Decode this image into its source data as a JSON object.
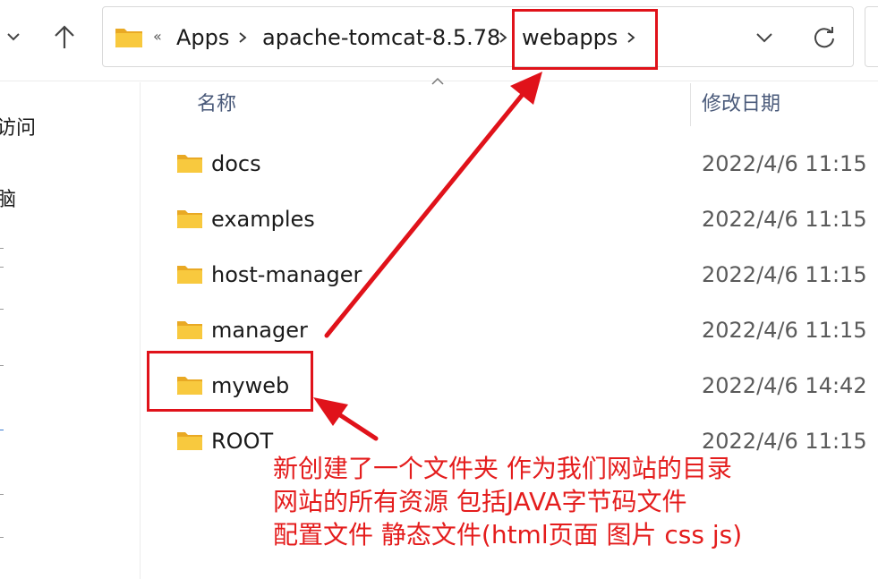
{
  "breadcrumb": {
    "overflow": "«",
    "items": [
      "Apps",
      "apache-tomcat-8.5.78",
      "webapps"
    ]
  },
  "sidebar": {
    "items": [
      "访问",
      "脑"
    ]
  },
  "columns": {
    "name": "名称",
    "modified": "修改日期"
  },
  "files": [
    {
      "name": "docs",
      "modified": "2022/4/6 11:15"
    },
    {
      "name": "examples",
      "modified": "2022/4/6 11:15"
    },
    {
      "name": "host-manager",
      "modified": "2022/4/6 11:15"
    },
    {
      "name": "manager",
      "modified": "2022/4/6 11:15"
    },
    {
      "name": "myweb",
      "modified": "2022/4/6 14:42"
    },
    {
      "name": "ROOT",
      "modified": "2022/4/6 11:15"
    }
  ],
  "annotation": {
    "lines": [
      "新创建了一个文件夹 作为我们网站的目录",
      "网站的所有资源 包括JAVA字节码文件",
      "配置文件 静态文件(html页面 图片 css js)"
    ]
  },
  "colors": {
    "annotation_red": "#e0121a",
    "folder_yellow": "#f8c93e",
    "header_text": "#4a5a7a"
  }
}
